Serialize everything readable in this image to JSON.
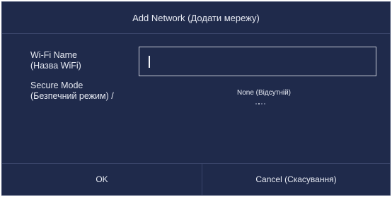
{
  "dialog": {
    "title": "Add Network (Додати мережу)",
    "wifi_name_label": "Wi-Fi Name\n(Назва WiFi)",
    "wifi_name_value": "",
    "secure_mode_label": "Secure Mode\n(Безпечний режим) /",
    "secure_mode_value": "None (Відсутній)",
    "ok_label": "OK",
    "cancel_label": "Cancel (Скасування)"
  },
  "colors": {
    "background": "#1f2a4b",
    "text": "#e6e9f2",
    "divider": "#3a456a",
    "input_border": "#c7cbd6"
  }
}
